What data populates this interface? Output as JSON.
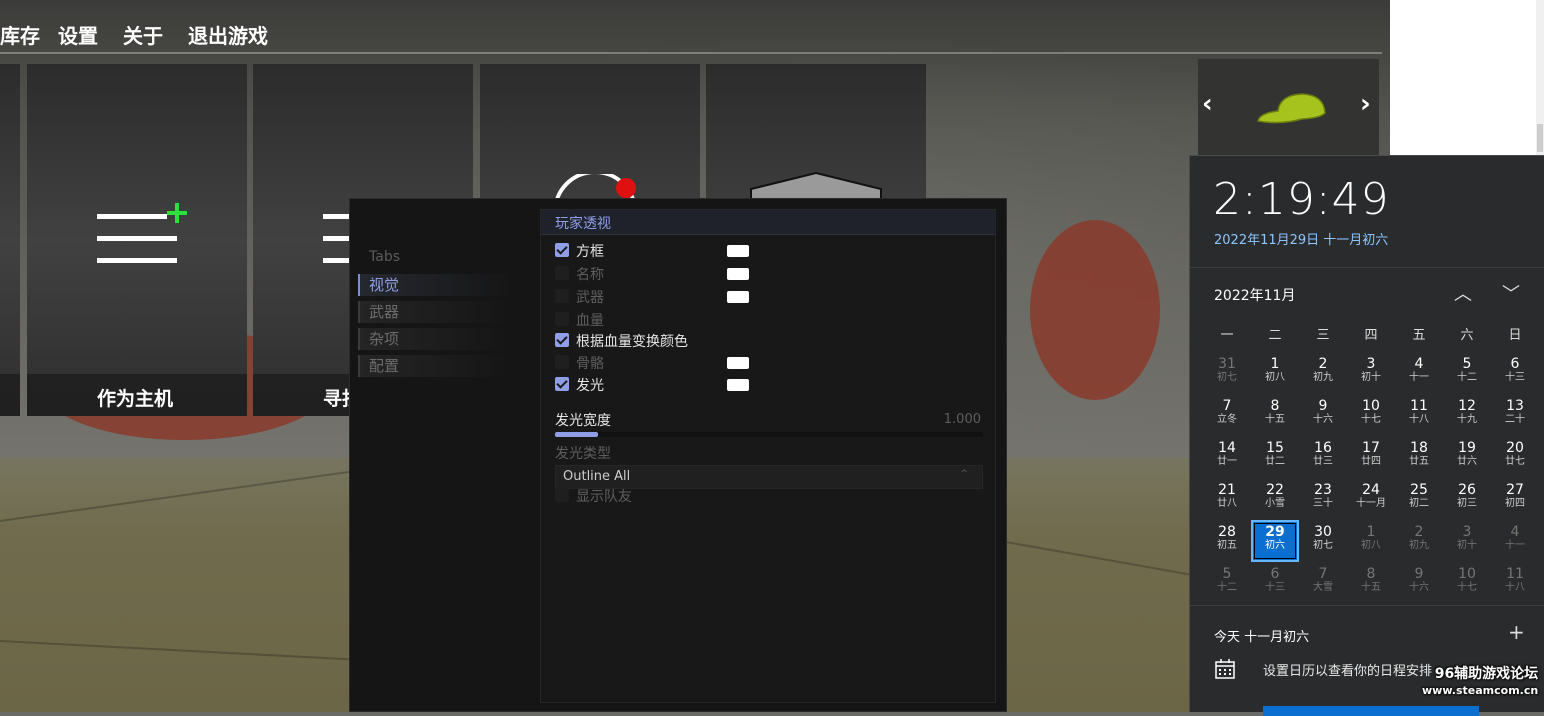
{
  "game": {
    "nav": [
      "库存",
      "设置",
      "关于",
      "退出游戏"
    ],
    "cards": [
      {
        "label": ""
      },
      {
        "label": "作为主机"
      },
      {
        "label": "寻找"
      },
      {
        "label": ""
      },
      {
        "label": ""
      }
    ],
    "preview": {
      "prev": "‹",
      "next": "›"
    }
  },
  "menu": {
    "tabs_title": "Tabs",
    "tabs": [
      "视觉",
      "武器",
      "杂项",
      "配置"
    ],
    "active_tab": 0,
    "section_title": "玩家透视",
    "options": [
      {
        "label": "方框",
        "checked": true,
        "has_color": true
      },
      {
        "label": "名称",
        "checked": false,
        "has_color": true
      },
      {
        "label": "武器",
        "checked": false,
        "has_color": true
      },
      {
        "label": "血量",
        "checked": false,
        "has_color": false
      },
      {
        "label": "根据血量变换颜色",
        "checked": true,
        "has_color": false
      },
      {
        "label": "骨骼",
        "checked": false,
        "has_color": true
      },
      {
        "label": "发光",
        "checked": true,
        "has_color": true
      }
    ],
    "slider": {
      "label": "发光宽度",
      "value_text": "1.000",
      "fill_fraction": 0.1
    },
    "glow_type_label": "发光类型",
    "glow_type_value": "Outline All",
    "glow_type_caret": "^",
    "show_team": {
      "label": "显示队友",
      "checked": false
    },
    "accent_color": "#8f9ee6"
  },
  "calendar": {
    "time": "2:19:49",
    "date_line": "2022年11月29日 十一月初六",
    "month_title": "2022年11月",
    "nav_up": "︿",
    "nav_down": "﹀",
    "weekdays": [
      "一",
      "二",
      "三",
      "四",
      "五",
      "六",
      "日"
    ],
    "days": [
      {
        "d": "31",
        "l": "初七",
        "m": true
      },
      {
        "d": "1",
        "l": "初八"
      },
      {
        "d": "2",
        "l": "初九"
      },
      {
        "d": "3",
        "l": "初十"
      },
      {
        "d": "4",
        "l": "十一"
      },
      {
        "d": "5",
        "l": "十二"
      },
      {
        "d": "6",
        "l": "十三"
      },
      {
        "d": "7",
        "l": "立冬"
      },
      {
        "d": "8",
        "l": "十五"
      },
      {
        "d": "9",
        "l": "十六"
      },
      {
        "d": "10",
        "l": "十七"
      },
      {
        "d": "11",
        "l": "十八"
      },
      {
        "d": "12",
        "l": "十九"
      },
      {
        "d": "13",
        "l": "二十"
      },
      {
        "d": "14",
        "l": "廿一"
      },
      {
        "d": "15",
        "l": "廿二"
      },
      {
        "d": "16",
        "l": "廿三"
      },
      {
        "d": "17",
        "l": "廿四"
      },
      {
        "d": "18",
        "l": "廿五"
      },
      {
        "d": "19",
        "l": "廿六"
      },
      {
        "d": "20",
        "l": "廿七"
      },
      {
        "d": "21",
        "l": "廿八"
      },
      {
        "d": "22",
        "l": "小雪"
      },
      {
        "d": "23",
        "l": "三十"
      },
      {
        "d": "24",
        "l": "十一月"
      },
      {
        "d": "25",
        "l": "初二"
      },
      {
        "d": "26",
        "l": "初三"
      },
      {
        "d": "27",
        "l": "初四"
      },
      {
        "d": "28",
        "l": "初五"
      },
      {
        "d": "29",
        "l": "初六",
        "today": true
      },
      {
        "d": "30",
        "l": "初七"
      },
      {
        "d": "1",
        "l": "初八",
        "m": true
      },
      {
        "d": "2",
        "l": "初九",
        "m": true
      },
      {
        "d": "3",
        "l": "初十",
        "m": true
      },
      {
        "d": "4",
        "l": "十一",
        "m": true
      },
      {
        "d": "5",
        "l": "十二",
        "m": true
      },
      {
        "d": "6",
        "l": "十三",
        "m": true
      },
      {
        "d": "7",
        "l": "大雪",
        "m": true
      },
      {
        "d": "8",
        "l": "十五",
        "m": true
      },
      {
        "d": "9",
        "l": "十六",
        "m": true
      },
      {
        "d": "10",
        "l": "十七",
        "m": true
      },
      {
        "d": "11",
        "l": "十八",
        "m": true
      }
    ],
    "today_label": "今天 十一月初六",
    "add_symbol": "+",
    "hint": "设置日历以查看你的日程安排",
    "accent_color": "#0a6fd1"
  },
  "watermark": {
    "line1": "96辅助游戏论坛",
    "line2": "www.steamcom.cn"
  }
}
